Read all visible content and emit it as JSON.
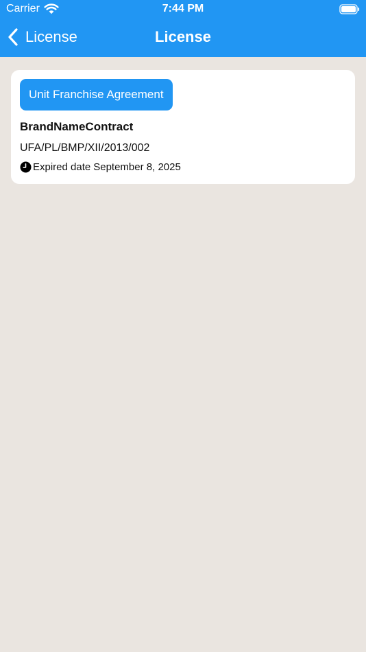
{
  "status_bar": {
    "carrier": "Carrier",
    "time": "7:44 PM",
    "wifi_icon": "wifi-icon",
    "battery_icon": "battery-icon"
  },
  "nav": {
    "back_label": "License",
    "back_icon": "chevron-left-icon",
    "title": "License"
  },
  "license_card": {
    "type_label": "Unit Franchise Agreement",
    "brand_name": "BrandNameContract",
    "contract_number": "UFA/PL/BMP/XII/2013/002",
    "expiry_icon": "clock-icon",
    "expiry_label": "Expired date",
    "expiry_date": "September 8, 2025"
  },
  "colors": {
    "primary": "#2196F3",
    "background": "#EAE5E0",
    "card": "#FFFFFF",
    "text": "#111111"
  }
}
